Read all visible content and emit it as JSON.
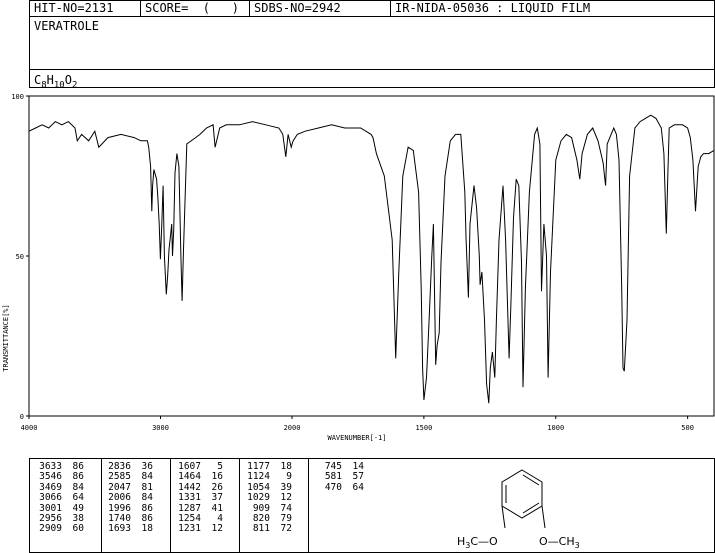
{
  "header": {
    "hit_no": "HIT-NO=2131",
    "score": "SCORE=  (   )",
    "sdbs_no": "SDBS-NO=2942",
    "method": "IR-NIDA-05036 : LIQUID FILM"
  },
  "compound_name": "VERATROLE",
  "formula": {
    "c": "C",
    "c_n": "8",
    "h": "H",
    "h_n": "10",
    "o": "O",
    "o_n": "2"
  },
  "chart_data": {
    "type": "line",
    "xlabel": "WAVENUMBER[-1]",
    "ylabel": "TRANSMITTANCE[%]",
    "xlim": [
      4000,
      400
    ],
    "ylim": [
      0,
      100
    ],
    "x_ticks": [
      "4000",
      "3000",
      "2000",
      "1500",
      "1000",
      "500"
    ],
    "y_ticks": [
      "100",
      "50",
      "0"
    ],
    "series": [
      {
        "x": [
          4000,
          3950,
          3900,
          3850,
          3800,
          3750,
          3700,
          3650,
          3633,
          3600,
          3546,
          3500,
          3469,
          3400,
          3300,
          3200,
          3150,
          3100,
          3090,
          3075,
          3066,
          3060,
          3050,
          3030,
          3020,
          3010,
          3001,
          2990,
          2980,
          2970,
          2956,
          2945,
          2935,
          2925,
          2915,
          2909,
          2900,
          2890,
          2875,
          2860,
          2850,
          2845,
          2836,
          2825,
          2800,
          2700,
          2650,
          2600,
          2585,
          2550,
          2500,
          2400,
          2300,
          2200,
          2100,
          2070,
          2047,
          2030,
          2006,
          1996,
          1980,
          1950,
          1900,
          1850,
          1800,
          1740,
          1720,
          1700,
          1693,
          1680,
          1650,
          1620,
          1607,
          1595,
          1580,
          1560,
          1540,
          1520,
          1510,
          1505,
          1500,
          1490,
          1480,
          1470,
          1464,
          1455,
          1450,
          1442,
          1435,
          1420,
          1400,
          1380,
          1360,
          1345,
          1340,
          1331,
          1325,
          1310,
          1300,
          1290,
          1287,
          1280,
          1270,
          1262,
          1254,
          1248,
          1240,
          1231,
          1225,
          1215,
          1200,
          1190,
          1177,
          1170,
          1160,
          1150,
          1140,
          1130,
          1124,
          1115,
          1100,
          1080,
          1070,
          1060,
          1054,
          1045,
          1035,
          1029,
          1020,
          1000,
          980,
          960,
          940,
          920,
          909,
          900,
          880,
          860,
          840,
          820,
          815,
          811,
          805,
          790,
          780,
          770,
          760,
          750,
          745,
          740,
          730,
          720,
          700,
          680,
          660,
          640,
          620,
          600,
          590,
          581,
          575,
          570,
          550,
          520,
          500,
          490,
          480,
          470,
          460,
          450,
          440,
          420,
          400
        ],
        "y": [
          89,
          90,
          91,
          90,
          92,
          91,
          92,
          90,
          86,
          88,
          86,
          89,
          84,
          87,
          88,
          87,
          86,
          86,
          84,
          78,
          64,
          72,
          77,
          74,
          68,
          60,
          49,
          60,
          72,
          50,
          38,
          44,
          52,
          56,
          60,
          50,
          58,
          76,
          82,
          78,
          60,
          50,
          36,
          52,
          85,
          88,
          90,
          91,
          84,
          90,
          91,
          91,
          92,
          91,
          90,
          88,
          81,
          88,
          84,
          86,
          88,
          89,
          90,
          91,
          90,
          90,
          89,
          88,
          87,
          82,
          75,
          55,
          18,
          45,
          75,
          84,
          83,
          70,
          40,
          15,
          5,
          12,
          30,
          50,
          60,
          16,
          22,
          26,
          48,
          75,
          86,
          88,
          88,
          70,
          55,
          37,
          60,
          72,
          65,
          50,
          41,
          45,
          30,
          10,
          4,
          15,
          20,
          12,
          30,
          55,
          72,
          55,
          18,
          35,
          62,
          74,
          72,
          48,
          9,
          40,
          70,
          88,
          90,
          85,
          39,
          60,
          50,
          12,
          45,
          80,
          86,
          88,
          87,
          80,
          74,
          82,
          88,
          90,
          86,
          79,
          75,
          72,
          85,
          88,
          90,
          88,
          80,
          40,
          15,
          14,
          30,
          75,
          90,
          92,
          93,
          94,
          93,
          90,
          82,
          57,
          75,
          90,
          91,
          91,
          90,
          87,
          80,
          64,
          78,
          81,
          82,
          82,
          83
        ]
      }
    ]
  },
  "peak_table": [
    [
      [
        "3633",
        "86"
      ],
      [
        "3546",
        "86"
      ],
      [
        "3469",
        "84"
      ],
      [
        "3066",
        "64"
      ],
      [
        "3001",
        "49"
      ],
      [
        "2956",
        "38"
      ],
      [
        "2909",
        "60"
      ]
    ],
    [
      [
        "2836",
        "36"
      ],
      [
        "2585",
        "84"
      ],
      [
        "2047",
        "81"
      ],
      [
        "2006",
        "84"
      ],
      [
        "1996",
        "86"
      ],
      [
        "1740",
        "86"
      ],
      [
        "1693",
        "18"
      ]
    ],
    [
      [
        "1607",
        "5"
      ],
      [
        "1464",
        "16"
      ],
      [
        "1442",
        "26"
      ],
      [
        "1331",
        "37"
      ],
      [
        "1287",
        "41"
      ],
      [
        "1254",
        "4"
      ],
      [
        "1231",
        "12"
      ]
    ],
    [
      [
        "1177",
        "18"
      ],
      [
        "1124",
        "9"
      ],
      [
        "1054",
        "39"
      ],
      [
        "1029",
        "12"
      ],
      [
        "909",
        "74"
      ],
      [
        "820",
        "79"
      ],
      [
        "811",
        "72"
      ]
    ],
    [
      [
        "745",
        "14"
      ],
      [
        "581",
        "57"
      ],
      [
        "470",
        "64"
      ]
    ]
  ],
  "structure": {
    "left_label": "H3C—O",
    "right_label": "O—CH3",
    "left_label_parts": [
      "H",
      "3",
      "C—O"
    ],
    "right_label_parts": [
      "O—CH",
      "3"
    ]
  }
}
